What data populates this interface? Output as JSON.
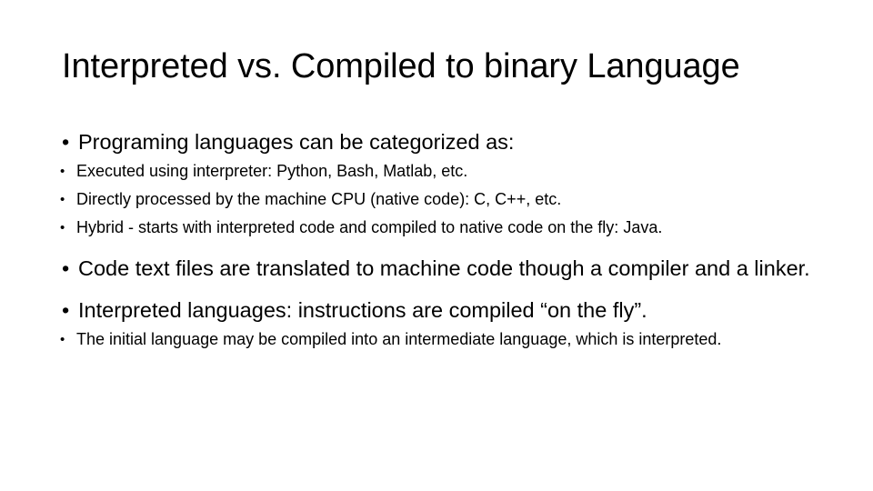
{
  "slide": {
    "title": "Interpreted vs. Compiled to binary Language",
    "background_color": "#ffffff",
    "text_color": "#000000",
    "bullet_glyph": "•",
    "content": {
      "item1": {
        "text": "Programing languages can be categorized as:",
        "children": {
          "child1": "Executed using interpreter: Python, Bash, Matlab, etc.",
          "child2": "Directly processed by the machine CPU (native code): C, C++, etc.",
          "child3": "Hybrid - starts with interpreted code and compiled to native code on the fly: Java."
        }
      },
      "item2": {
        "text": "Code text files are translated to machine code though a compiler and a linker."
      },
      "item3": {
        "text": "Interpreted languages: instructions are compiled “on the fly”.",
        "children": {
          "child1": "The initial language may be compiled into an intermediate language, which is interpreted."
        }
      }
    }
  }
}
